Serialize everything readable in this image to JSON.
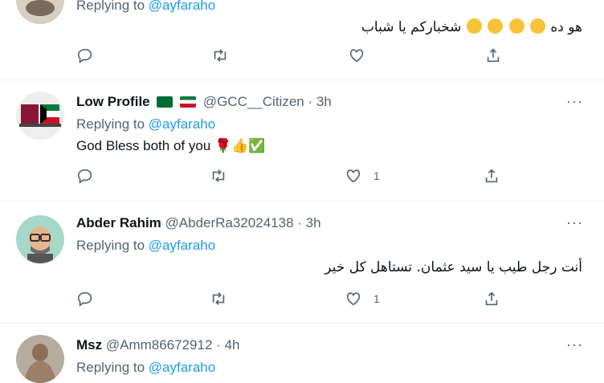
{
  "tweets": [
    {
      "text": "هو ده 😁😁😁😁 شخباركم يا شباب",
      "reply_prefix": "Replying to",
      "reply_link": "@ayfaraho",
      "actions": {
        "reply_count": "",
        "retweet_count": "",
        "like_count": ""
      }
    },
    {
      "name": "Low Profile",
      "handle": "@GCC__Citizen",
      "dot": "·",
      "time": "3h",
      "reply_prefix": "Replying to",
      "reply_link": "@ayfaraho",
      "text": "God Bless both of you 🌹👍✅",
      "actions": {
        "reply_count": "",
        "retweet_count": "",
        "like_count": "1"
      }
    },
    {
      "name": "Abder Rahim",
      "handle": "@AbderRa32024138",
      "dot": "·",
      "time": "3h",
      "reply_prefix": "Replying to",
      "reply_link": "@ayfaraho",
      "text": "أنت رجل طيب يا سيد عثمان. تستاهل كل خير",
      "actions": {
        "reply_count": "",
        "retweet_count": "",
        "like_count": "1"
      }
    },
    {
      "name": "Msz",
      "handle": "@Amm86672912",
      "dot": "·",
      "time": "4h",
      "reply_prefix": "Replying to",
      "reply_link": "@ayfaraho"
    }
  ],
  "more_label": "···",
  "colors": {
    "link": "#1d9bf0",
    "muted": "#536471",
    "text": "#0f1419",
    "border": "#eff3f4"
  }
}
